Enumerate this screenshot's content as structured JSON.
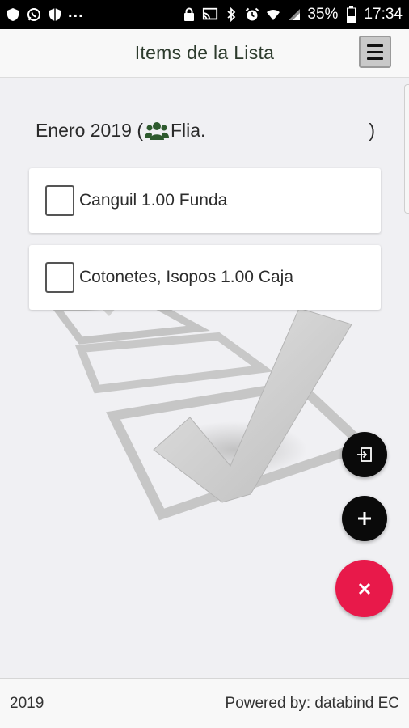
{
  "status_bar": {
    "battery": "35%",
    "time": "17:34",
    "left_icons": [
      "shield-icon",
      "whatsapp-icon",
      "shield-icon"
    ],
    "overflow": "...",
    "right_icons": [
      "lock-icon",
      "cast-icon",
      "bluetooth-icon",
      "alarm-icon",
      "wifi-icon",
      "signal-icon",
      "battery-icon"
    ]
  },
  "header": {
    "title": "Items de la Lista",
    "menu_icon": "hamburger-icon"
  },
  "list": {
    "name": "Enero 2019 (",
    "group_icon": "users-icon",
    "group_label": "Flia.",
    "closing": ")"
  },
  "items": [
    {
      "label": "Canguil 1.00 Funda",
      "checked": false
    },
    {
      "label": "Cotonetes, Isopos 1.00 Caja",
      "checked": false
    }
  ],
  "fabs": {
    "export_icon": "export-icon",
    "add_icon": "plus-icon",
    "close_icon": "close-icon",
    "close_color": "#e8194a"
  },
  "footer": {
    "year": "2019",
    "credit": "Powered by: databind EC"
  },
  "colors": {
    "accent": "#e8194a",
    "heading_icon": "#2e5a2e",
    "background": "#f0f0f3"
  }
}
